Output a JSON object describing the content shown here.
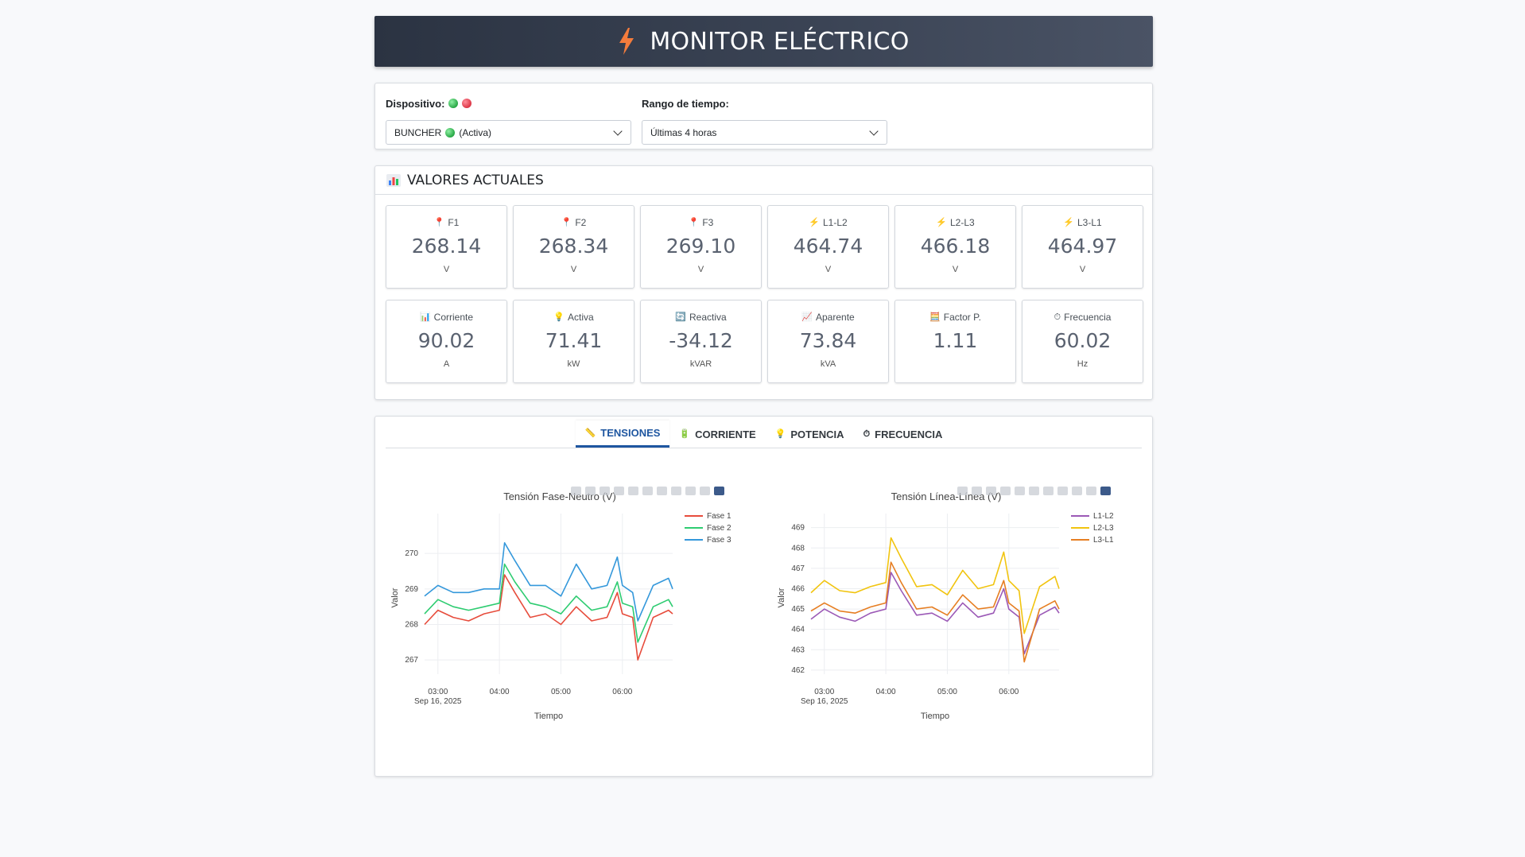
{
  "header": {
    "title": "MONITOR ELÉCTRICO",
    "icon": "lightning-bolt-icon"
  },
  "controls": {
    "device_label": "Dispositivo:",
    "device_value": "BUNCHER",
    "device_status": "(Activa)",
    "range_label": "Rango de tiempo:",
    "range_value": "Últimas 4 horas"
  },
  "values": {
    "title": "VALORES ACTUALES",
    "tiles": [
      {
        "icon": "📍",
        "label": "F1",
        "value": "268.14",
        "unit": "V"
      },
      {
        "icon": "📍",
        "label": "F2",
        "value": "268.34",
        "unit": "V"
      },
      {
        "icon": "📍",
        "label": "F3",
        "value": "269.10",
        "unit": "V"
      },
      {
        "icon": "⚡",
        "label": "L1-L2",
        "value": "464.74",
        "unit": "V"
      },
      {
        "icon": "⚡",
        "label": "L2-L3",
        "value": "466.18",
        "unit": "V"
      },
      {
        "icon": "⚡",
        "label": "L3-L1",
        "value": "464.97",
        "unit": "V"
      },
      {
        "icon": "📊",
        "label": "Corriente",
        "value": "90.02",
        "unit": "A"
      },
      {
        "icon": "💡",
        "label": "Activa",
        "value": "71.41",
        "unit": "kW"
      },
      {
        "icon": "🔄",
        "label": "Reactiva",
        "value": "-34.12",
        "unit": "kVAR"
      },
      {
        "icon": "📈",
        "label": "Aparente",
        "value": "73.84",
        "unit": "kVA"
      },
      {
        "icon": "🧮",
        "label": "Factor P.",
        "value": "1.11",
        "unit": ""
      },
      {
        "icon": "⏱",
        "label": "Frecuencia",
        "value": "60.02",
        "unit": "Hz"
      }
    ]
  },
  "tabs": [
    {
      "icon": "📏",
      "label": "TENSIONES"
    },
    {
      "icon": "🔋",
      "label": "CORRIENTE"
    },
    {
      "icon": "💡",
      "label": "POTENCIA"
    },
    {
      "icon": "⏱",
      "label": "FRECUENCIA"
    }
  ],
  "chart_data": [
    {
      "type": "line",
      "title": "Tensión Fase-Neutro (V)",
      "xlabel": "Tiempo",
      "ylabel": "Valor",
      "x_ticks": [
        "03:00",
        "04:00",
        "05:00",
        "06:00"
      ],
      "x_sublabel": "Sep 16, 2025",
      "y_ticks": [
        267,
        268,
        269,
        270
      ],
      "ylim": [
        266.6,
        270.9
      ],
      "legend": "top-right",
      "x": [
        "02:47",
        "03:00",
        "03:15",
        "03:30",
        "03:45",
        "04:00",
        "04:05",
        "04:15",
        "04:30",
        "04:45",
        "05:00",
        "05:15",
        "05:30",
        "05:45",
        "05:55",
        "06:00",
        "06:10",
        "06:15",
        "06:30",
        "06:45",
        "06:49"
      ],
      "series": [
        {
          "name": "Fase 1",
          "color": "#e74c3c",
          "values": [
            268.0,
            268.4,
            268.2,
            268.1,
            268.3,
            268.4,
            269.4,
            268.9,
            268.2,
            268.3,
            268.0,
            268.5,
            268.1,
            268.2,
            268.9,
            268.3,
            268.2,
            267.0,
            268.2,
            268.4,
            268.3
          ]
        },
        {
          "name": "Fase 2",
          "color": "#2ecc71",
          "values": [
            268.3,
            268.7,
            268.5,
            268.4,
            268.5,
            268.6,
            269.7,
            269.2,
            268.6,
            268.5,
            268.3,
            268.8,
            268.4,
            268.5,
            269.2,
            268.6,
            268.5,
            267.5,
            268.5,
            268.7,
            268.5
          ]
        },
        {
          "name": "Fase 3",
          "color": "#3498db",
          "values": [
            268.8,
            269.1,
            268.9,
            268.9,
            269.0,
            269.0,
            270.3,
            269.8,
            269.1,
            269.1,
            268.8,
            269.7,
            269.0,
            269.1,
            269.9,
            269.1,
            268.9,
            268.1,
            269.1,
            269.3,
            269.0
          ]
        }
      ]
    },
    {
      "type": "line",
      "title": "Tensión Línea-Línea (V)",
      "xlabel": "Tiempo",
      "ylabel": "Valor",
      "x_ticks": [
        "03:00",
        "04:00",
        "05:00",
        "06:00"
      ],
      "x_sublabel": "Sep 16, 2025",
      "y_ticks": [
        462,
        463,
        464,
        465,
        466,
        467,
        468,
        469
      ],
      "ylim": [
        461.8,
        469.3
      ],
      "legend": "top-right",
      "x": [
        "02:47",
        "03:00",
        "03:15",
        "03:30",
        "03:45",
        "04:00",
        "04:05",
        "04:15",
        "04:30",
        "04:45",
        "05:00",
        "05:15",
        "05:30",
        "05:45",
        "05:55",
        "06:00",
        "06:10",
        "06:15",
        "06:30",
        "06:45",
        "06:49"
      ],
      "series": [
        {
          "name": "L1-L2",
          "color": "#9b59b6",
          "values": [
            464.5,
            465.0,
            464.6,
            464.4,
            464.8,
            465.0,
            466.8,
            465.9,
            464.7,
            464.8,
            464.4,
            465.3,
            464.6,
            464.8,
            466.0,
            465.0,
            464.6,
            462.8,
            464.7,
            465.1,
            464.8
          ]
        },
        {
          "name": "L2-L3",
          "color": "#f1c40f",
          "values": [
            465.8,
            466.4,
            465.9,
            465.8,
            466.1,
            466.3,
            468.5,
            467.5,
            466.1,
            466.2,
            465.7,
            466.9,
            466.0,
            466.2,
            467.8,
            466.4,
            465.9,
            463.8,
            466.1,
            466.6,
            466.0
          ]
        },
        {
          "name": "L3-L1",
          "color": "#e67e22",
          "values": [
            464.9,
            465.3,
            464.9,
            464.8,
            465.1,
            465.3,
            467.3,
            466.3,
            465.0,
            465.1,
            464.7,
            465.7,
            465.0,
            465.1,
            466.4,
            465.3,
            464.9,
            462.4,
            465.0,
            465.4,
            465.0
          ]
        }
      ]
    }
  ]
}
